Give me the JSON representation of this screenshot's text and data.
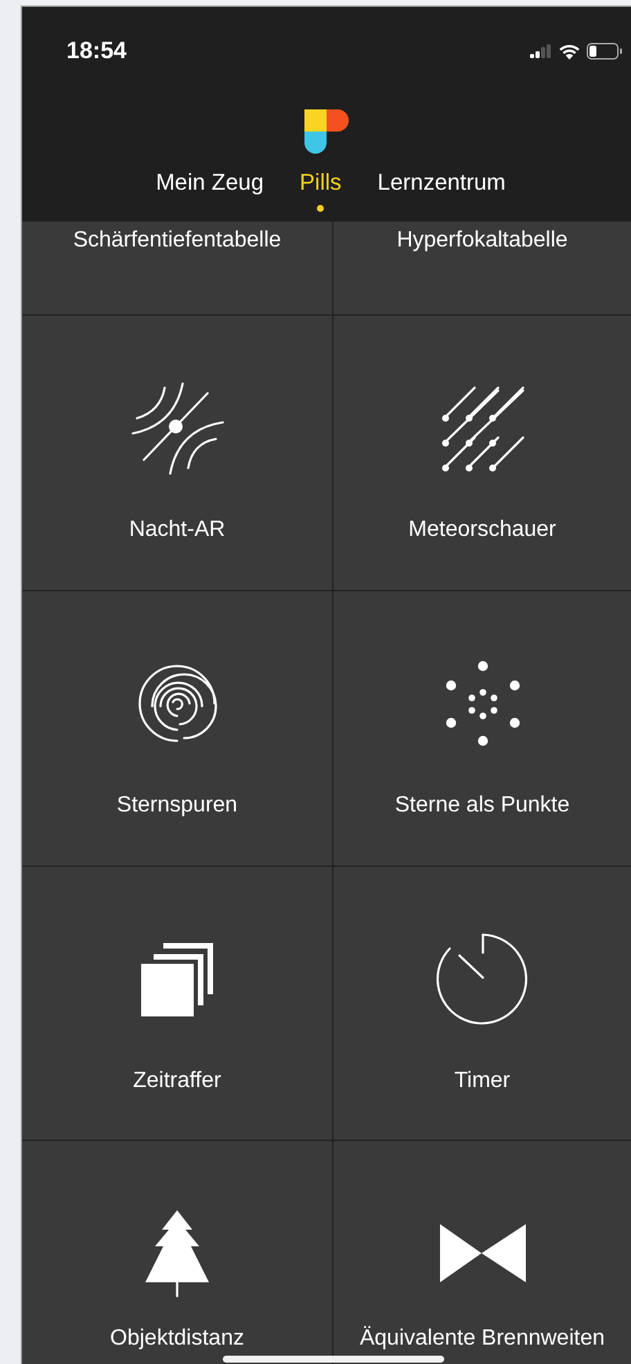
{
  "status_bar": {
    "time": "18:54"
  },
  "tabs": [
    {
      "label": "Mein Zeug",
      "selected": false
    },
    {
      "label": "Pills",
      "selected": true
    },
    {
      "label": "Lernzentrum",
      "selected": false
    }
  ],
  "tools": [
    {
      "label": "Schärfentiefentabelle",
      "kind": "cut"
    },
    {
      "label": "Hyperfokaltabelle",
      "kind": "cut"
    },
    {
      "label": "Nacht-AR",
      "kind": "night-ar"
    },
    {
      "label": "Meteorschauer",
      "kind": "meteor"
    },
    {
      "label": "Sternspuren",
      "kind": "trails"
    },
    {
      "label": "Sterne als Punkte",
      "kind": "dots"
    },
    {
      "label": "Zeitraffer",
      "kind": "timelapse"
    },
    {
      "label": "Timer",
      "kind": "timer"
    },
    {
      "label": "Objektdistanz",
      "kind": "tree"
    },
    {
      "label": "Äquivalente Brennweiten",
      "kind": "bowtie"
    }
  ]
}
